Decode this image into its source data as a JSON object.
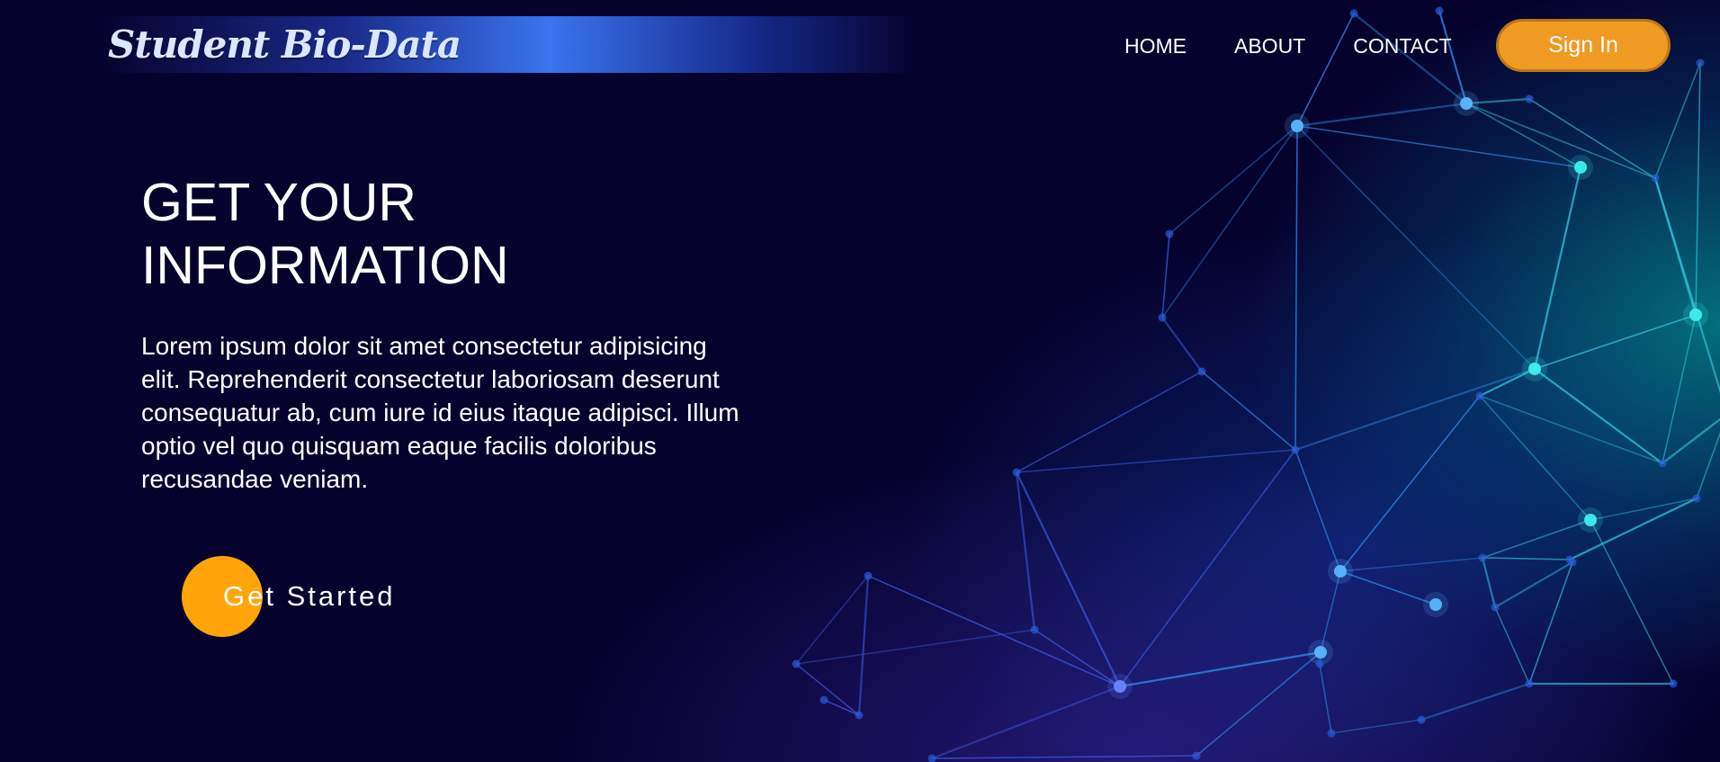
{
  "header": {
    "brand": "Student Bio-Data",
    "nav": [
      "HOME",
      "ABOUT",
      "CONTACT"
    ],
    "signin_label": "Sign In"
  },
  "hero": {
    "title_line1": "GET YOUR",
    "title_line2": "INFORMATION",
    "description": "Lorem ipsum dolor sit amet consectetur adipisicing elit. Reprehenderit consectetur laboriosam deserunt consequatur ab, cum iure id eius itaque adipisci. Illum optio vel quo quisquam eaque facilis doloribus recusandae veniam.",
    "cta_label": "Get Started"
  },
  "colors": {
    "background": "#06022e",
    "accent_orange": "#ef9a22",
    "cta_circle": "#ffa50a",
    "network_blue": "#3a74ee",
    "network_cyan": "#19e0e8"
  }
}
